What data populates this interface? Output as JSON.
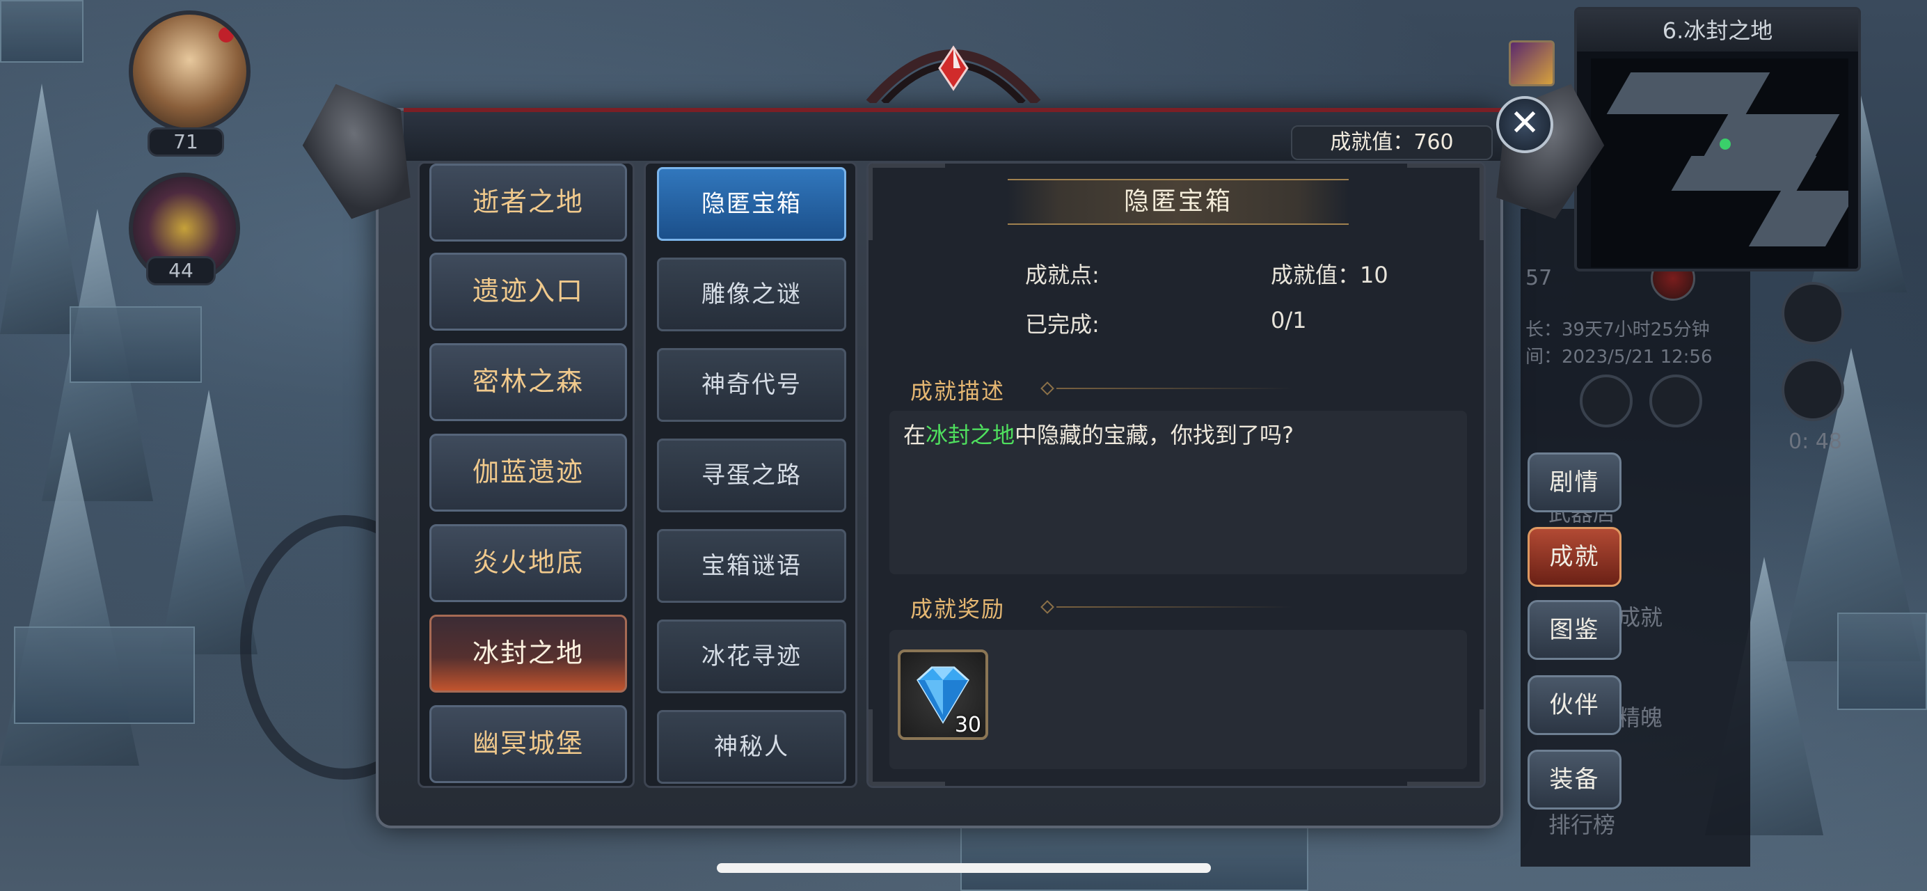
{
  "scene": {
    "portraits": [
      {
        "name": "hero",
        "level": "71"
      },
      {
        "name": "pet",
        "level": "44"
      }
    ]
  },
  "minimap": {
    "title": "6.冰封之地"
  },
  "side_info": {
    "number": "57",
    "duration": "长：39天7小时25分钟",
    "time": "间：2023/5/21 12:56",
    "timer": "0: 48",
    "bg_labels": [
      "武器店",
      "成就",
      "精魄",
      "排行榜"
    ]
  },
  "side_tabs": [
    {
      "label": "剧情",
      "active": false
    },
    {
      "label": "成就",
      "active": true
    },
    {
      "label": "图鉴",
      "active": false
    },
    {
      "label": "伙伴",
      "active": false
    },
    {
      "label": "装备",
      "active": false
    }
  ],
  "dialog": {
    "score_label": "成就值：760",
    "close_label": "✕",
    "regions": [
      {
        "label": "逝者之地",
        "active": false
      },
      {
        "label": "遗迹入口",
        "active": false
      },
      {
        "label": "密林之森",
        "active": false
      },
      {
        "label": "伽蓝遗迹",
        "active": false
      },
      {
        "label": "炎火地底",
        "active": false
      },
      {
        "label": "冰封之地",
        "active": true
      },
      {
        "label": "幽冥城堡",
        "active": false
      }
    ],
    "achievements": [
      {
        "label": "隐匿宝箱",
        "active": true
      },
      {
        "label": "雕像之谜",
        "active": false
      },
      {
        "label": "神奇代号",
        "active": false
      },
      {
        "label": "寻蛋之路",
        "active": false
      },
      {
        "label": "宝箱谜语",
        "active": false
      },
      {
        "label": "冰花寻迹",
        "active": false
      },
      {
        "label": "神秘人",
        "active": false
      }
    ],
    "detail": {
      "title": "隐匿宝箱",
      "points_label": "成就点:",
      "points_value": "成就值：10",
      "completed_label": "已完成:",
      "completed_value": "0/1",
      "desc_title": "成就描述",
      "desc_prefix": "在",
      "desc_highlight": "冰封之地",
      "desc_suffix": "中隐藏的宝藏，你找到了吗?",
      "reward_title": "成就奖励",
      "reward_item": {
        "icon": "blue-diamond-icon",
        "count": "30"
      }
    }
  },
  "colors": {
    "accent_gold": "#e5b772",
    "highlight_green": "#4fe05e",
    "active_blue": "#3177bd",
    "active_red": "#c2542e"
  }
}
